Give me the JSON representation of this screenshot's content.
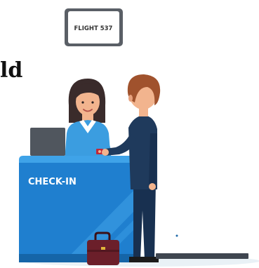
{
  "sign": {
    "text": "FLIGHT 537"
  },
  "counter": {
    "label": "CHECK-IN"
  },
  "partial_heading": "ld",
  "colors": {
    "counter_blue": "#1f7fcf",
    "counter_dark": "#1565a8",
    "counter_top": "#3fa3e8",
    "agent_shirt": "#3b9de0",
    "agent_hair": "#3a2b2b",
    "traveler_coat": "#1f3a5c",
    "traveler_hair": "#a0522d",
    "suitcase": "#6b1f2a",
    "floor_shadow": "#e9f1f6"
  }
}
